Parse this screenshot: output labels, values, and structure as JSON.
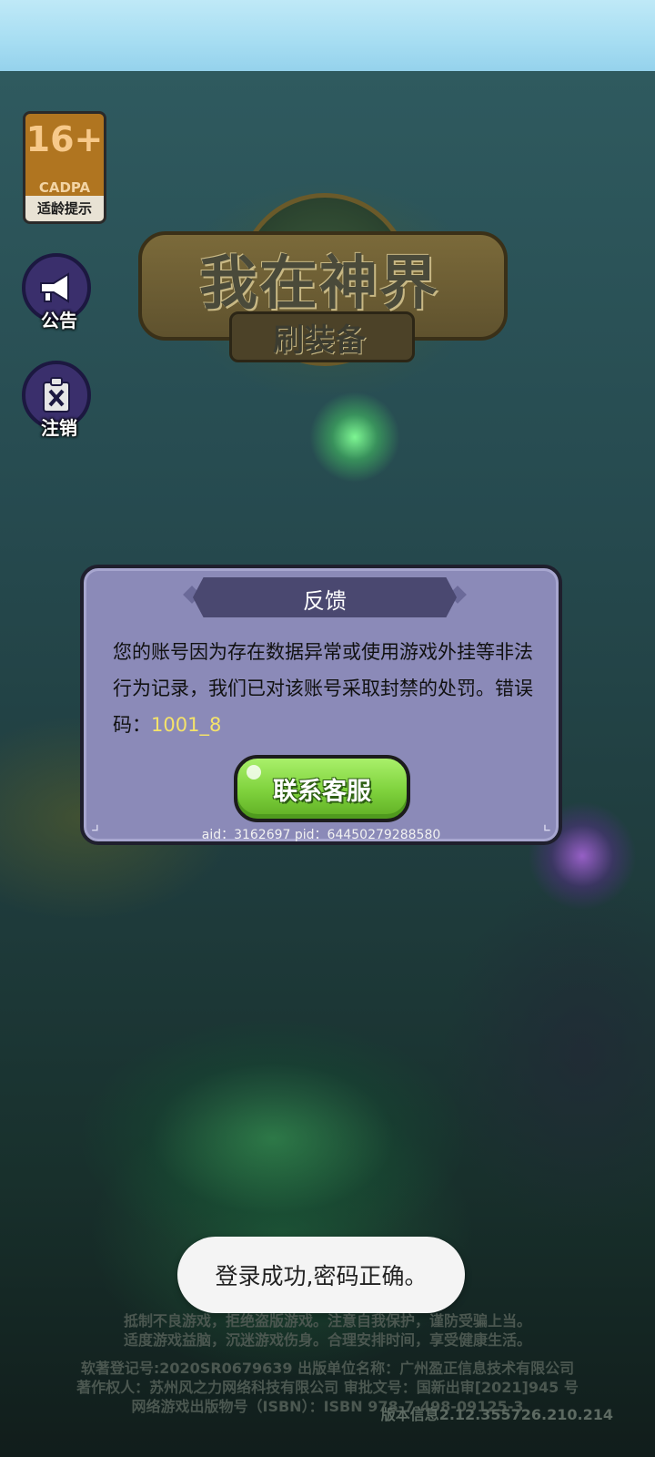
{
  "age_rating": {
    "age": "16+",
    "org": "CADPA",
    "hint": "适龄提示"
  },
  "side_buttons": [
    {
      "label": "公告",
      "icon": "megaphone-icon"
    },
    {
      "label": "注销",
      "icon": "cancel-account-icon"
    }
  ],
  "logo": {
    "title": "我在神界",
    "subtitle": "刷装备"
  },
  "dialog": {
    "title": "反馈",
    "message": "您的账号因为存在数据异常或使用游戏外挂等非法行为记录，我们已对该账号采取封禁的处罚。错误码：",
    "error_code": "1001_8",
    "button_label": "联系客服",
    "ids": "aid：3162697  pid：64450279288580"
  },
  "toast": "登录成功,密码正确。",
  "footer": {
    "lines": [
      "抵制不良游戏，拒绝盗版游戏。注意自我保护，谨防受骗上当。",
      "适度游戏益脑，沉迷游戏伤身。合理安排时间，享受健康生活。",
      "软著登记号:2020SR0679639 出版单位名称：广州盈正信息技术有限公司",
      "著作权人：苏州风之力网络科技有限公司 审批文号：国新出审[2021]945 号",
      "网络游戏出版物号（ISBN）：ISBN 978-7-498-09125-3"
    ],
    "version": "版本信息2.12.355726.210.214"
  },
  "colors": {
    "dialog_bg": "#8b8ab8",
    "dialog_header": "#4a4870",
    "button_green": "#7ed13c",
    "error_code": "#f5e36a",
    "age_badge": "#b07520"
  }
}
